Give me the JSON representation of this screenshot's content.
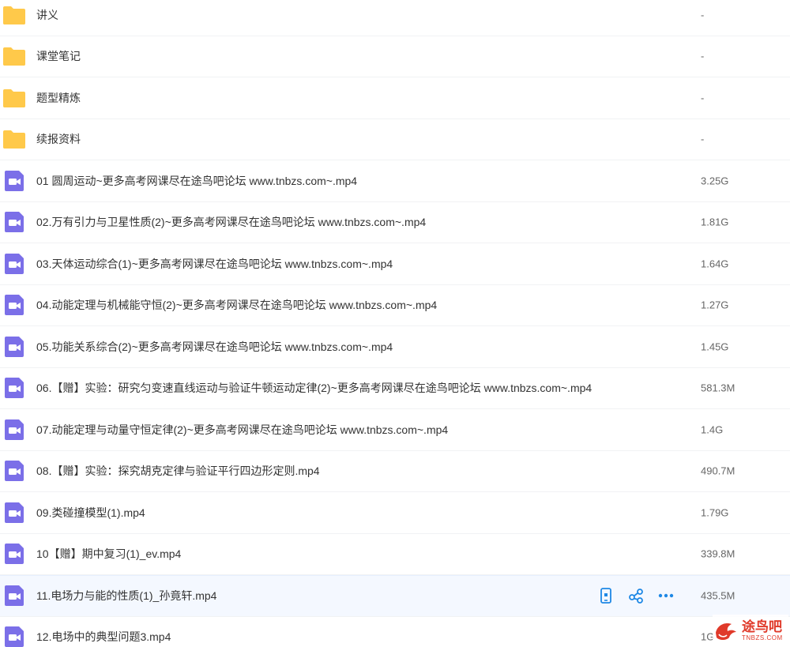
{
  "colors": {
    "folder": "#FFC94A",
    "video": "#7B6FE8",
    "action": "#1E88E5",
    "watermark": "#E03A2A"
  },
  "files": [
    {
      "name": "讲义",
      "size": "-",
      "type": "folder"
    },
    {
      "name": "课堂笔记",
      "size": "-",
      "type": "folder"
    },
    {
      "name": "题型精炼",
      "size": "-",
      "type": "folder"
    },
    {
      "name": "续报资料",
      "size": "-",
      "type": "folder"
    },
    {
      "name": "01 圆周运动~更多高考网课尽在途鸟吧论坛 www.tnbzs.com~.mp4",
      "size": "3.25G",
      "type": "video"
    },
    {
      "name": "02.万有引力与卫星性质(2)~更多高考网课尽在途鸟吧论坛 www.tnbzs.com~.mp4",
      "size": "1.81G",
      "type": "video"
    },
    {
      "name": "03.天体运动综合(1)~更多高考网课尽在途鸟吧论坛 www.tnbzs.com~.mp4",
      "size": "1.64G",
      "type": "video"
    },
    {
      "name": "04.动能定理与机械能守恒(2)~更多高考网课尽在途鸟吧论坛 www.tnbzs.com~.mp4",
      "size": "1.27G",
      "type": "video"
    },
    {
      "name": "05.功能关系综合(2)~更多高考网课尽在途鸟吧论坛 www.tnbzs.com~.mp4",
      "size": "1.45G",
      "type": "video"
    },
    {
      "name": "06.【赠】实验：研究匀变速直线运动与验证牛顿运动定律(2)~更多高考网课尽在途鸟吧论坛 www.tnbzs.com~.mp4",
      "size": "581.3M",
      "type": "video"
    },
    {
      "name": "07.动能定理与动量守恒定律(2)~更多高考网课尽在途鸟吧论坛 www.tnbzs.com~.mp4",
      "size": "1.4G",
      "type": "video"
    },
    {
      "name": "08.【赠】实验：探究胡克定律与验证平行四边形定则.mp4",
      "size": "490.7M",
      "type": "video"
    },
    {
      "name": "09.类碰撞模型(1).mp4",
      "size": "1.79G",
      "type": "video"
    },
    {
      "name": "10【赠】期中复习(1)_ev.mp4",
      "size": "339.8M",
      "type": "video"
    },
    {
      "name": "11.电场力与能的性质(1)_孙竟轩.mp4",
      "size": "435.5M",
      "type": "video",
      "hovered": true
    },
    {
      "name": "12.电场中的典型问题3.mp4",
      "size": "1G",
      "type": "video"
    }
  ],
  "row_actions": [
    {
      "name": "phone-icon"
    },
    {
      "name": "share-icon"
    },
    {
      "name": "more-icon"
    }
  ],
  "watermark": {
    "title": "途鸟吧",
    "subtitle": "TNBZS.COM"
  }
}
